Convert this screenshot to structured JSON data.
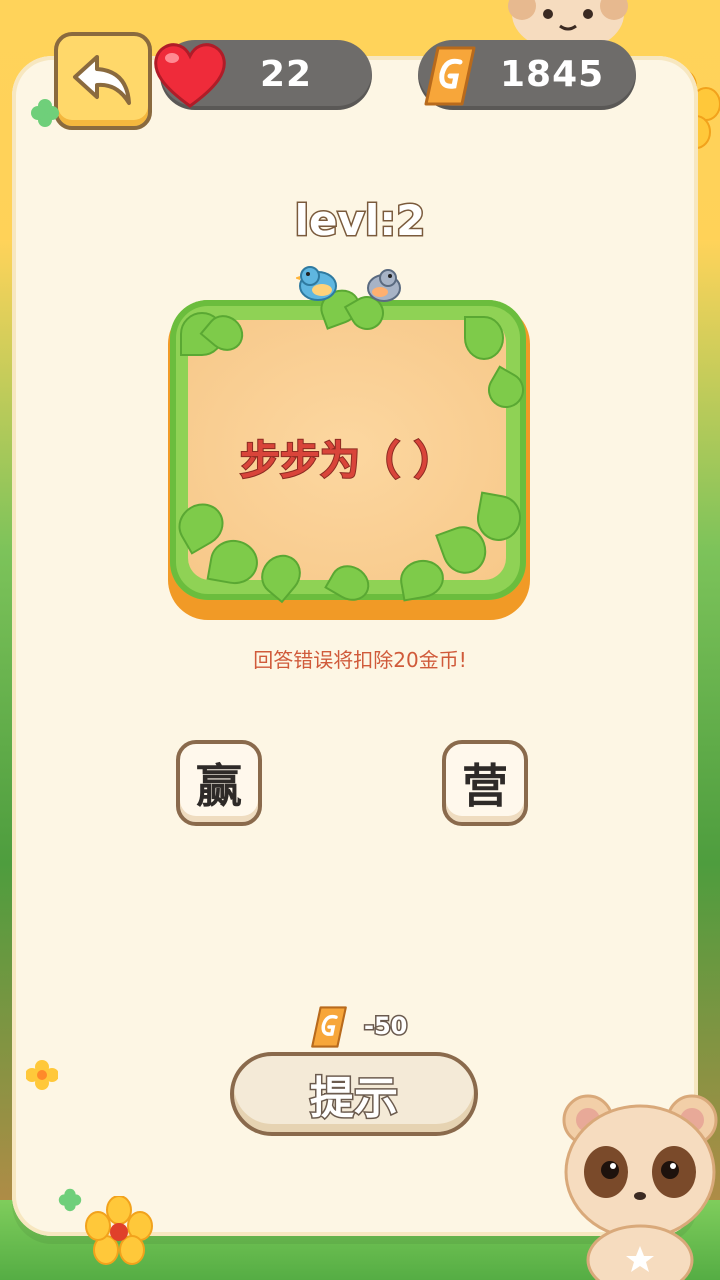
{
  "hud": {
    "lives": "22",
    "coins": "1845"
  },
  "level": {
    "label": "levl:2"
  },
  "question": {
    "text": "步步为（  ）",
    "warning": "回答错误将扣除20金币!"
  },
  "answers": [
    "赢",
    "营"
  ],
  "hint": {
    "cost": "-50",
    "label": "提示"
  },
  "colors": {
    "accent_red": "#d9443a",
    "board_green": "#8fd255",
    "panel_bg": "#fdf6e4",
    "pill_bg": "#6e6c6a"
  }
}
